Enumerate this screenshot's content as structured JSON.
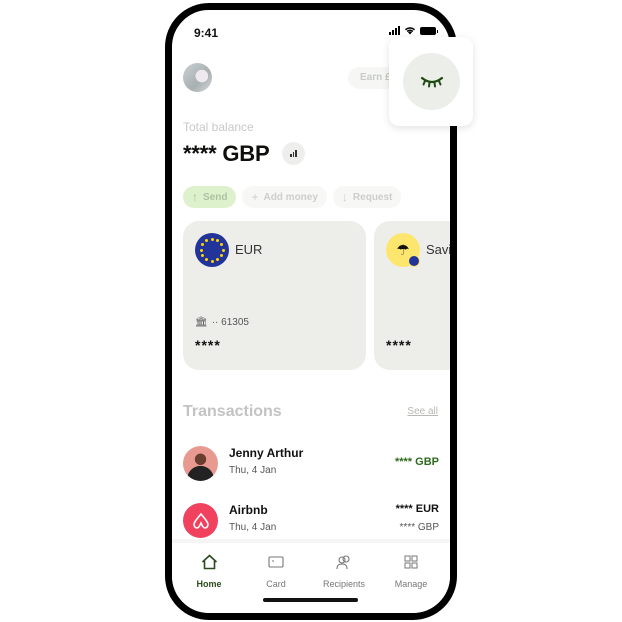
{
  "status_bar": {
    "time": "9:41"
  },
  "header": {
    "earn_label": "Earn £"
  },
  "balance": {
    "label": "Total balance",
    "value": "**** GBP"
  },
  "actions": [
    {
      "label": "Send",
      "icon": "arrow-up-icon",
      "glyph": "↑"
    },
    {
      "label": "Add money",
      "icon": "plus-icon",
      "glyph": "+"
    },
    {
      "label": "Request",
      "icon": "arrow-down-icon",
      "glyph": "↓"
    }
  ],
  "accounts": [
    {
      "currency": "EUR",
      "account_number": "·· 61305",
      "balance": "****",
      "bank_glyph": "🏛"
    },
    {
      "name": "Savi",
      "balance": "****",
      "glyph": "☂"
    }
  ],
  "transactions": {
    "title": "Transactions",
    "see_all": "See all",
    "items": [
      {
        "name": "Jenny Arthur",
        "date": "Thu, 4 Jan",
        "amount": "**** GBP"
      },
      {
        "name": "Airbnb",
        "date": "Thu, 4 Jan",
        "amount": "**** EUR",
        "sub_amount": "**** GBP"
      }
    ]
  },
  "nav": [
    {
      "label": "Home",
      "icon": "home-icon",
      "active": true
    },
    {
      "label": "Card",
      "icon": "card-icon"
    },
    {
      "label": "Recipients",
      "icon": "recipients-icon"
    },
    {
      "label": "Manage",
      "icon": "manage-icon"
    }
  ],
  "colors": {
    "accent_green": "#2e6a1e",
    "send_green": "#c4e7a6",
    "card_bg": "#edeeea",
    "eu_blue": "#22349a",
    "airbnb": "#f0415e"
  }
}
